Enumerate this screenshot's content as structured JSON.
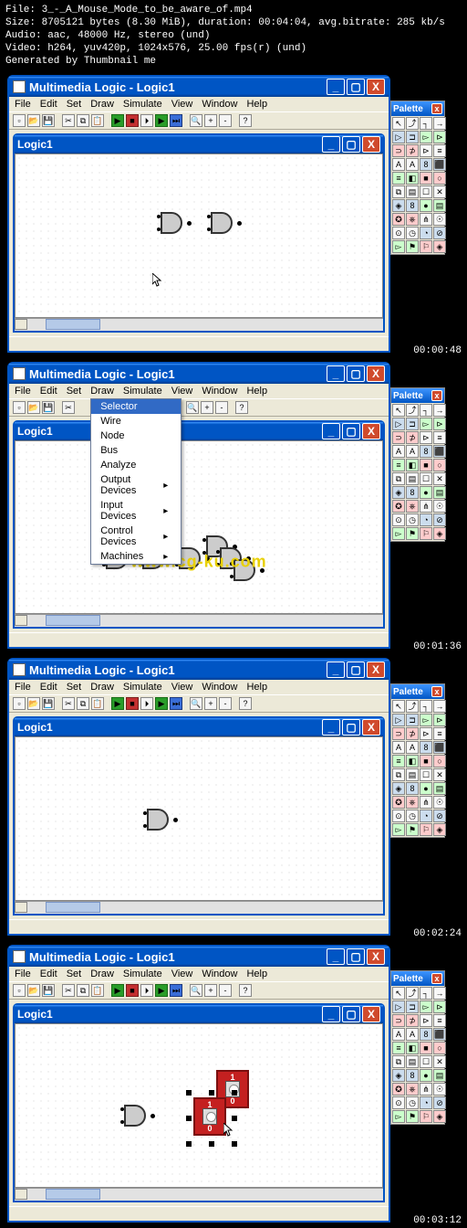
{
  "meta": {
    "file": "File: 3_-_A_Mouse_Mode_to_be_aware_of.mp4",
    "size": "Size: 8705121 bytes (8.30 MiB), duration: 00:04:04, avg.bitrate: 285 kb/s",
    "audio": "Audio: aac, 48000 Hz, stereo (und)",
    "video": "Video: h264, yuv420p, 1024x576, 25.00 fps(r) (und)",
    "generated": "Generated by Thumbnail me"
  },
  "app": {
    "title": "Multimedia Logic - Logic1",
    "child_title": "Logic1",
    "palette_title": "Palette",
    "menu": [
      "File",
      "Edit",
      "Set",
      "Draw",
      "Simulate",
      "View",
      "Window",
      "Help"
    ]
  },
  "dropdown": {
    "items": [
      "Selector",
      "Wire",
      "Node",
      "Bus",
      "Analyze",
      "Output Devices",
      "Input Devices",
      "Control Devices",
      "Machines"
    ],
    "highlighted": 0,
    "submenu_flags": [
      false,
      false,
      false,
      false,
      false,
      true,
      true,
      true,
      true
    ]
  },
  "watermark": "www.cg-ku.com",
  "timestamps": [
    "00:00:48",
    "00:01:36",
    "00:02:24",
    "00:03:12"
  ],
  "switch_labels": {
    "top": "1",
    "bottom": "0"
  },
  "palette_icons": [
    "↖",
    "⤴",
    "┐",
    "→",
    "▷",
    "⊐",
    "▻",
    "⊳",
    "⊃",
    "⊅",
    "⊳",
    "≡",
    "A",
    "A",
    "8",
    "⬛",
    "≡",
    "◧",
    "■",
    "○",
    "⧉",
    "▤",
    "☐",
    "✕",
    "◈",
    "8",
    "●",
    "▤",
    "✪",
    "⎈",
    "⋔",
    "☉",
    "⊙",
    "◷",
    "◔",
    "⊘",
    "▻",
    "⚑",
    "⚐",
    "◈"
  ]
}
